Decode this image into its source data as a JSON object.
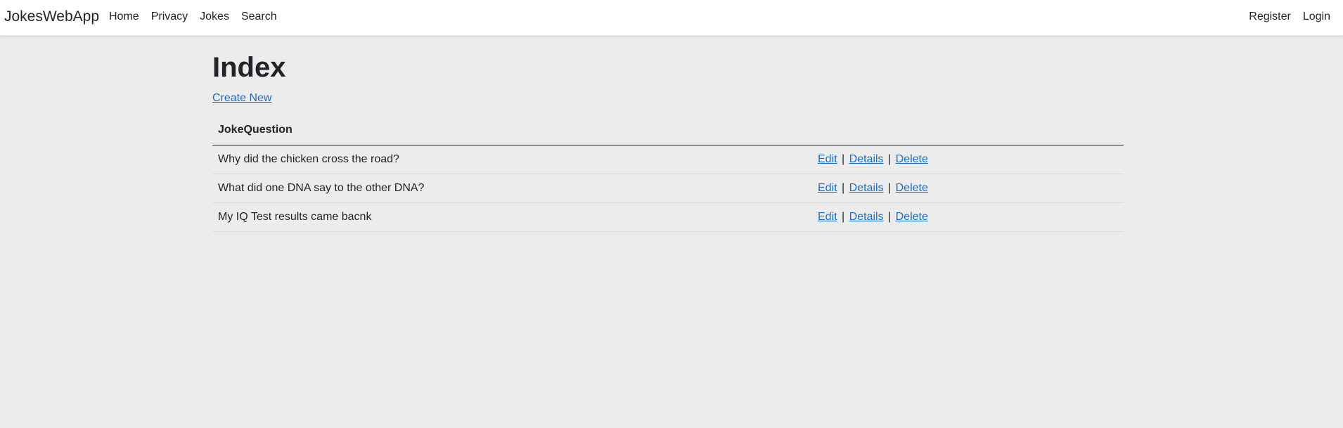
{
  "nav": {
    "brand": "JokesWebApp",
    "left": [
      "Home",
      "Privacy",
      "Jokes",
      "Search"
    ],
    "right": [
      "Register",
      "Login"
    ]
  },
  "page": {
    "title": "Index",
    "create_link": "Create New"
  },
  "table": {
    "header": "JokeQuestion",
    "actions": [
      "Edit",
      "Details",
      "Delete"
    ],
    "separator": "|",
    "rows": [
      "Why did the chicken cross the road?",
      "What did one DNA say to the other DNA?",
      "My IQ Test results came bacnk"
    ]
  },
  "colors": {
    "link": "#1b6ec2",
    "background": "#ececec",
    "navbar": "#ffffff"
  }
}
